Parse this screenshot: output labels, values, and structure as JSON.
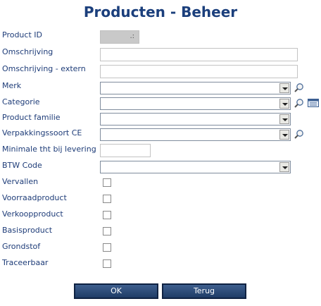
{
  "header": {
    "title": "Producten - Beheer"
  },
  "fields": {
    "product_id": {
      "label": "Product ID",
      "lookup_glyph": ".:"
    },
    "omschrijving": {
      "label": "Omschrijving",
      "value": ""
    },
    "omschrijving_extern": {
      "label": "Omschrijving - extern",
      "value": ""
    },
    "merk": {
      "label": "Merk",
      "value": ""
    },
    "categorie": {
      "label": "Categorie",
      "value": ""
    },
    "product_familie": {
      "label": "Product familie",
      "value": ""
    },
    "verpakkingssoort": {
      "label": "Verpakkingssoort CE",
      "value": ""
    },
    "minimale_tht": {
      "label": "Minimale tht bij levering",
      "value": ""
    },
    "btw_code": {
      "label": "BTW Code",
      "value": ""
    },
    "vervallen": {
      "label": "Vervallen",
      "checked": false
    },
    "voorraadproduct": {
      "label": "Voorraadproduct",
      "checked": false
    },
    "verkoopproduct": {
      "label": "Verkoopproduct",
      "checked": false
    },
    "basisproduct": {
      "label": "Basisproduct",
      "checked": false
    },
    "grondstof": {
      "label": "Grondstof",
      "checked": false
    },
    "traceerbaar": {
      "label": "Traceerbaar",
      "checked": false
    }
  },
  "buttons": {
    "ok": "OK",
    "back": "Terug"
  },
  "colors": {
    "label": "#1e3c78",
    "title": "#1b3f7c",
    "button": "#2a4a78"
  }
}
